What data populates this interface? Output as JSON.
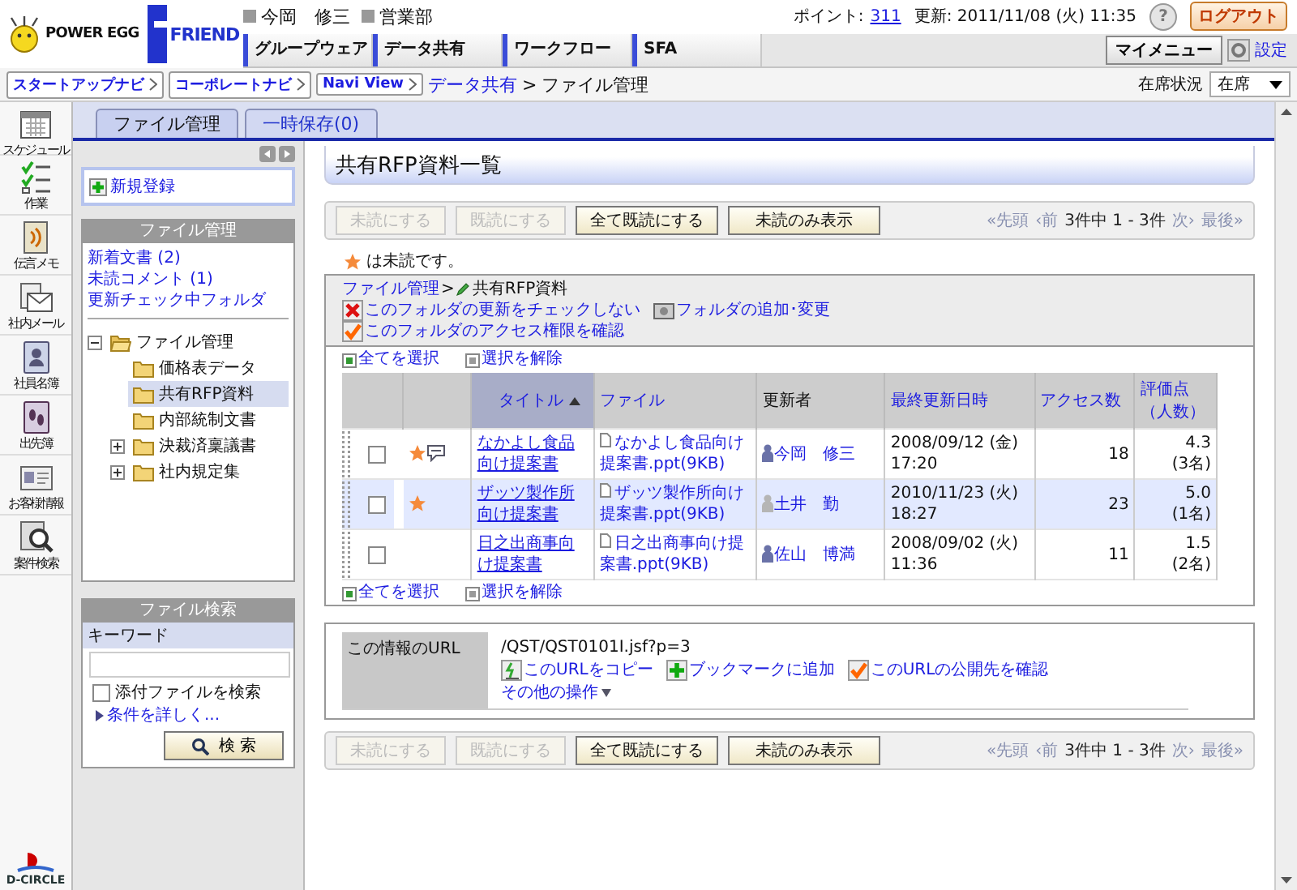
{
  "header": {
    "logo": "POWER EGG",
    "product": "FRIEND",
    "user": "今岡　修三",
    "department": "営業部",
    "points_label": "ポイント:",
    "points": "311",
    "updated": "更新: 2011/11/08 (火) 11:35",
    "help": "?",
    "logout": "ログアウト",
    "my_menu": "マイメニュー",
    "settings": "設定"
  },
  "nav_tabs": [
    "グループウェア",
    "データ共有",
    "ワークフロー",
    "SFA"
  ],
  "navi_buttons": [
    "スタートアップナビ",
    "コーポレートナビ",
    "Navi View"
  ],
  "breadcrumb": {
    "link": "データ共有",
    "separator": ">",
    "current": "ファイル管理"
  },
  "presence": {
    "label": "在席状況",
    "value": "在席"
  },
  "app_icons": [
    {
      "label": "スケジュール",
      "kind": "calendar"
    },
    {
      "label": "作業",
      "kind": "tasks"
    },
    {
      "label": "伝言メモ",
      "kind": "memo"
    },
    {
      "label": "社内メール",
      "kind": "mail"
    },
    {
      "label": "社員名簿",
      "kind": "directory"
    },
    {
      "label": "出先簿",
      "kind": "outing"
    },
    {
      "label": "お客様情報",
      "kind": "customer"
    },
    {
      "label": "案件検索",
      "kind": "search"
    }
  ],
  "brand": "D-CIRCLE",
  "tabs": [
    {
      "label": "ファイル管理",
      "selected": true
    },
    {
      "label": "一時保存(0)",
      "selected": false
    }
  ],
  "sidebar": {
    "new_button": "新規登録",
    "panel_title": "ファイル管理",
    "links": [
      "新着文書 (2)",
      "未読コメント (1)",
      "更新チェック中フォルダ"
    ],
    "tree": [
      {
        "label": "ファイル管理",
        "expanded": true,
        "selected": false,
        "children": [
          {
            "label": "価格表データ",
            "selected": false
          },
          {
            "label": "共有RFP資料",
            "selected": true
          },
          {
            "label": "内部統制文書",
            "selected": false
          },
          {
            "label": "決裁済稟議書",
            "expanded": false,
            "selected": false
          },
          {
            "label": "社内規定集",
            "expanded": false,
            "selected": false
          }
        ]
      }
    ],
    "search": {
      "title": "ファイル検索",
      "keyword_label": "キーワード",
      "attachments": {
        "label": "添付ファイルを検索",
        "checked": false
      },
      "details_link": "条件を詳しく...",
      "button": "検 索"
    }
  },
  "main": {
    "title": "共有RFP資料一覧",
    "toolbar_top": {
      "buttons": [
        {
          "label": "未読にする",
          "disabled": true
        },
        {
          "label": "既読にする",
          "disabled": true
        },
        {
          "label": "全て既読にする",
          "disabled": false
        },
        {
          "label": "未読のみ表示",
          "disabled": false
        }
      ],
      "pager": {
        "first": "«先頭",
        "prev": "‹前",
        "range": "3件中 1 - 3件",
        "next": "次›",
        "last": "最後»"
      }
    },
    "legend": "は未読です。",
    "folder_path": {
      "parent": "ファイル管理",
      "separator": ">",
      "current": "共有RFP資料"
    },
    "folder_actions": [
      {
        "label": "このフォルダの更新をチェックしない",
        "kind": "uncheck"
      },
      {
        "label": "フォルダの追加･変更",
        "kind": "folder"
      },
      {
        "label": "このフォルダのアクセス権限を確認",
        "kind": "check"
      }
    ],
    "select_top": {
      "select_all": "全てを選択",
      "deselect": "選択を解除"
    },
    "columns": [
      {
        "label": "タイトル",
        "sorted": true,
        "link": true
      },
      {
        "label": "ファイル",
        "sorted": false,
        "link": true
      },
      {
        "label": "更新者",
        "sorted": false,
        "link": false
      },
      {
        "label": "最終更新日時",
        "sorted": false,
        "link": true
      },
      {
        "label": "アクセス数",
        "sorted": false,
        "link": true
      },
      {
        "label": "評価点（人数）",
        "sorted": false,
        "link": true
      }
    ],
    "rows": [
      {
        "checked": false,
        "unread": true,
        "has_comment": true,
        "title": "なかよし食品向け提案書",
        "file": "なかよし食品向け提案書.ppt(9KB)",
        "updater": "今岡　修三",
        "updater_present": true,
        "date": "2008/09/12 (金)",
        "time": "17:20",
        "access": "18",
        "rating": "4.3",
        "raters": "(3名)"
      },
      {
        "checked": false,
        "unread": true,
        "has_comment": false,
        "title": "ザッツ製作所向け提案書",
        "file": "ザッツ製作所向け提案書.ppt(9KB)",
        "updater": "土井　勤",
        "updater_present": false,
        "date": "2010/11/23 (火)",
        "time": "18:27",
        "access": "23",
        "rating": "5.0",
        "raters": "(1名)"
      },
      {
        "checked": false,
        "unread": false,
        "has_comment": false,
        "title": "日之出商事向け提案書",
        "file": "日之出商事向け提案書.ppt(9KB)",
        "updater": "佐山　博満",
        "updater_present": true,
        "date": "2008/09/02 (火)",
        "time": "11:36",
        "access": "11",
        "rating": "1.5",
        "raters": "(2名)"
      }
    ],
    "select_bottom": {
      "select_all": "全てを選択",
      "deselect": "選択を解除"
    },
    "url_box": {
      "label": "この情報のURL",
      "url": "/QST/QST0101I.jsf?p=3",
      "actions": [
        {
          "label": "このURLをコピー",
          "kind": "copy"
        },
        {
          "label": "ブックマークに追加",
          "kind": "add"
        },
        {
          "label": "このURLの公開先を確認",
          "kind": "check"
        }
      ],
      "more": "その他の操作"
    },
    "toolbar_bottom": {
      "buttons": [
        {
          "label": "未読にする",
          "disabled": true
        },
        {
          "label": "既読にする",
          "disabled": true
        },
        {
          "label": "全て既読にする",
          "disabled": false
        },
        {
          "label": "未読のみ表示",
          "disabled": false
        }
      ],
      "pager": {
        "first": "«先頭",
        "prev": "‹前",
        "range": "3件中 1 - 3件",
        "next": "次›",
        "last": "最後»"
      }
    }
  }
}
